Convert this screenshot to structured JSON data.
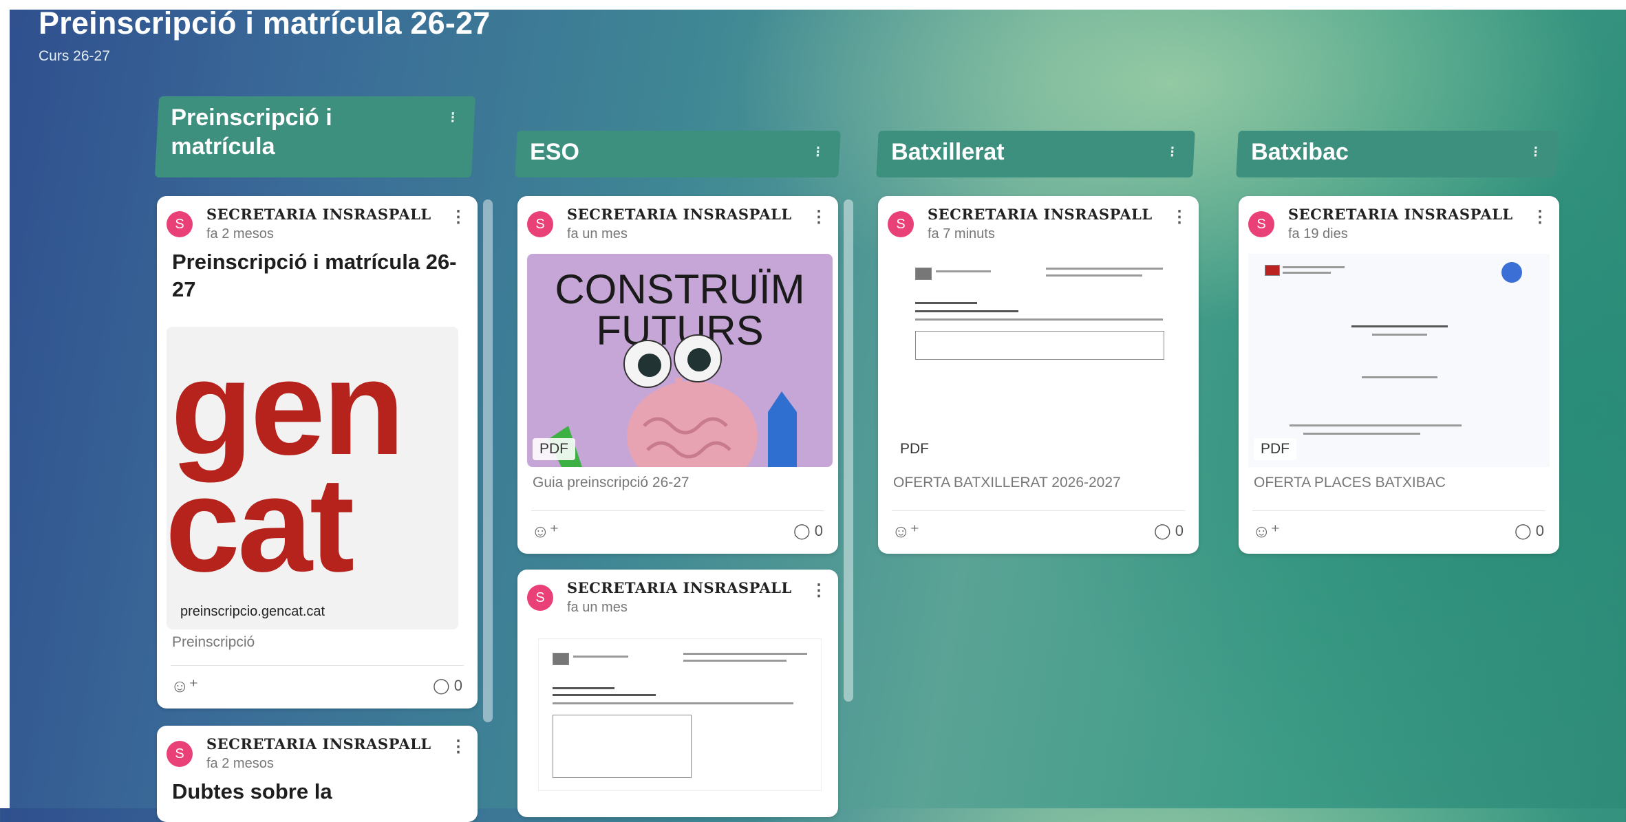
{
  "board": {
    "title": "Preinscripció i matrícula 26-27",
    "subtitle": "Curs 26-27"
  },
  "columns": [
    {
      "title": "Preinscripció i matrícula"
    },
    {
      "title": "ESO"
    },
    {
      "title": "Batxillerat"
    },
    {
      "title": "Batxibac"
    }
  ],
  "kebab": "⁝",
  "posts": {
    "p1": {
      "author": "SECRETARIA INSRASPALL",
      "avatar": "S",
      "time": "fa 2 mesos",
      "title": "Preinscripció i matrícula 26-27",
      "preview_lines": [
        "gen",
        "cat"
      ],
      "link_url": "preinscripcio.gencat.cat",
      "caption": "Preinscripció",
      "comments": "0"
    },
    "p2": {
      "author": "SECRETARIA INSRASPALL",
      "avatar": "S",
      "time": "fa 2 mesos",
      "title": "Dubtes sobre la"
    },
    "p3": {
      "author": "SECRETARIA INSRASPALL",
      "avatar": "S",
      "time": "fa un mes",
      "preview_lines": [
        "CONSTRUÏM",
        "FUTURS"
      ],
      "file_type": "PDF",
      "caption": "Guia preinscripció 26-27",
      "comments": "0"
    },
    "p4": {
      "author": "SECRETARIA INSRASPALL",
      "avatar": "S",
      "time": "fa un mes"
    },
    "p5": {
      "author": "SECRETARIA INSRASPALL",
      "avatar": "S",
      "time": "fa 7 minuts",
      "file_type": "PDF",
      "caption": "OFERTA BATXILLERAT 2026-2027",
      "comments": "0"
    },
    "p6": {
      "author": "SECRETARIA INSRASPALL",
      "avatar": "S",
      "time": "fa 19 dies",
      "file_type": "PDF",
      "caption": "OFERTA PLACES BATXIBAC",
      "comments": "0"
    }
  },
  "icons": {
    "reaction": "add-reaction-icon",
    "comment": "comment-icon",
    "menu": "more-vertical-icon"
  },
  "colors": {
    "column_header": "#3d8f7e",
    "avatar": "#e94077",
    "gencat_red": "#b5231c"
  }
}
